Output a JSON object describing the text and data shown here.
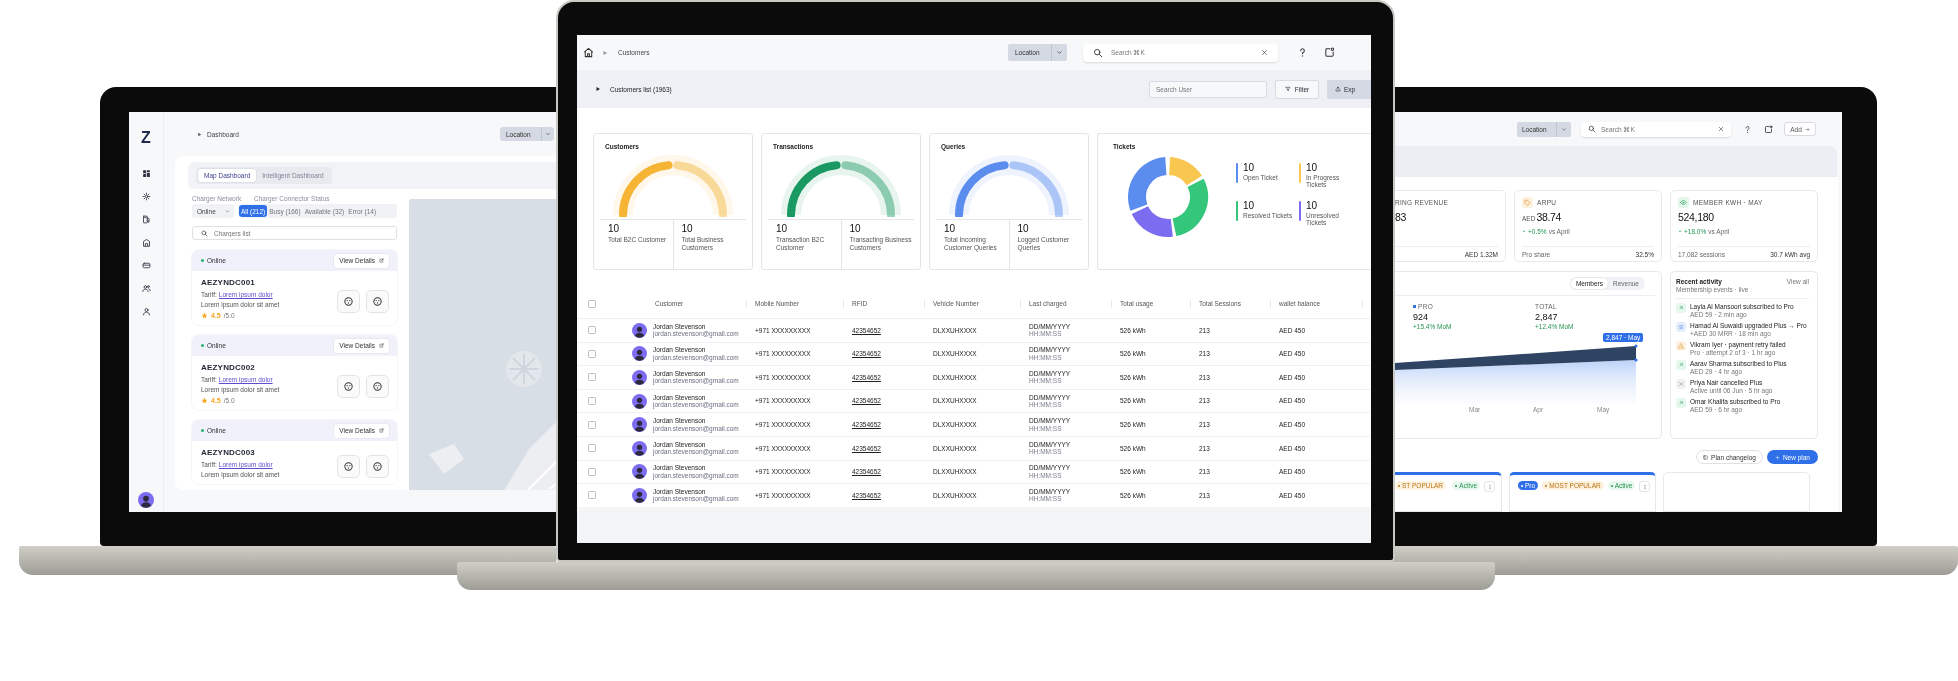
{
  "left_screen": {
    "logo": "Z",
    "breadcrumb": "Dashboard",
    "location": "Location",
    "tabs": [
      {
        "label": "Map Dashboard",
        "selected": true
      },
      {
        "label": "Intelligent Dashboard",
        "selected": false
      }
    ],
    "network": {
      "label": "Charger Network",
      "value": "Online"
    },
    "connector_status": {
      "label": "Charger Connector Status",
      "filters": [
        {
          "label": "All (212)",
          "selected": true
        },
        {
          "label": "Busy (166)",
          "selected": false
        },
        {
          "label": "Available (32)",
          "selected": false
        },
        {
          "label": "Error (14)",
          "selected": false
        }
      ]
    },
    "search": {
      "placeholder": "Chargers list"
    },
    "chargers": [
      {
        "status": "Online",
        "action": "View Details",
        "id": "AEZYNDC001",
        "tariff_label": "Tariff:",
        "tariff": "Lorem ipsum dolor",
        "description": "Lorem ipsum dolor sit amet",
        "rating": "4.5",
        "rating_scale": "/5.0"
      },
      {
        "status": "Online",
        "action": "View Details",
        "id": "AEZYNDC002",
        "tariff_label": "Tariff:",
        "tariff": "Lorem ipsum dolor",
        "description": "Lorem ipsum dolor sit amet",
        "rating": "4.5",
        "rating_scale": "/5.0"
      },
      {
        "status": "Online",
        "action": "View Details",
        "id": "AEZYNDC003",
        "tariff_label": "Tariff:",
        "tariff": "Lorem ipsum dolor",
        "description": "Lorem ipsum dolor sit amet"
      }
    ]
  },
  "main_screen": {
    "breadcrumb": "Customers",
    "location": "Location",
    "search": {
      "placeholder": "Search ⌘K"
    },
    "list_title": "Customers list (1963)",
    "user_search": {
      "placeholder": "Search User"
    },
    "filter_button": "Filter",
    "export_button": "Exp",
    "stat_cards": [
      {
        "title": "Customers",
        "color": "#f5b433",
        "stats": [
          {
            "value": "10",
            "label": "Total B2C Customer"
          },
          {
            "value": "10",
            "label": "Total Business Customers"
          }
        ]
      },
      {
        "title": "Transactions",
        "color": "#1a9a62",
        "stats": [
          {
            "value": "10",
            "label": "Transaction B2C Customer"
          },
          {
            "value": "10",
            "label": "Transacting Business Customers"
          }
        ]
      },
      {
        "title": "Queries",
        "color": "#5b8def",
        "stats": [
          {
            "value": "10",
            "label": "Total Incoming Customer Queries"
          },
          {
            "value": "10",
            "label": "Logged Customer Queries"
          }
        ]
      }
    ],
    "tickets": {
      "title": "Tickets",
      "legend": [
        {
          "value": "10",
          "label": "Open Ticket",
          "color": "#5b8def"
        },
        {
          "value": "10",
          "label": "In Progress Tickets",
          "color": "#f9c74f"
        },
        {
          "value": "10",
          "label": "Resolved Tickets",
          "color": "#34c77b"
        },
        {
          "value": "10",
          "label": "Unresolved Tickets",
          "color": "#7b6cf0"
        }
      ]
    },
    "table": {
      "columns": [
        "Customer",
        "Mobile Number",
        "RFID",
        "Vehicle Number",
        "Last charged",
        "Total usage",
        "Total Sessions",
        "wallet balance"
      ],
      "select_all_checked": false,
      "rows": [
        {
          "checked": false,
          "name": "Jordan Stevenson",
          "email": "jordan.stevenson@gmail.com",
          "mobile": "+971 XXXXXXXXX",
          "rfid": "42354652",
          "vehicle": "DLXXUHXXXX",
          "date": "DD/MM/YYYY",
          "time": "HH:MM:SS",
          "usage": "526 kWh",
          "sessions": "213",
          "balance": "AED 450"
        },
        {
          "checked": false,
          "name": "Jordan Stevenson",
          "email": "jordan.stevenson@gmail.com",
          "mobile": "+971 XXXXXXXXX",
          "rfid": "42354652",
          "vehicle": "DLXXUHXXXX",
          "date": "DD/MM/YYYY",
          "time": "HH:MM:SS",
          "usage": "526 kWh",
          "sessions": "213",
          "balance": "AED 450"
        },
        {
          "checked": false,
          "name": "Jordan Stevenson",
          "email": "jordan.stevenson@gmail.com",
          "mobile": "+971 XXXXXXXXX",
          "rfid": "42354652",
          "vehicle": "DLXXUHXXXX",
          "date": "DD/MM/YYYY",
          "time": "HH:MM:SS",
          "usage": "526 kWh",
          "sessions": "213",
          "balance": "AED 450"
        },
        {
          "checked": false,
          "name": "Jordan Stevenson",
          "email": "jordan.stevenson@gmail.com",
          "mobile": "+971 XXXXXXXXX",
          "rfid": "42354652",
          "vehicle": "DLXXUHXXXX",
          "date": "DD/MM/YYYY",
          "time": "HH:MM:SS",
          "usage": "526 kWh",
          "sessions": "213",
          "balance": "AED 450"
        },
        {
          "checked": false,
          "name": "Jordan Stevenson",
          "email": "jordan.stevenson@gmail.com",
          "mobile": "+971 XXXXXXXXX",
          "rfid": "42354652",
          "vehicle": "DLXXUHXXXX",
          "date": "DD/MM/YYYY",
          "time": "HH:MM:SS",
          "usage": "526 kWh",
          "sessions": "213",
          "balance": "AED 450"
        },
        {
          "checked": false,
          "name": "Jordan Stevenson",
          "email": "jordan.stevenson@gmail.com",
          "mobile": "+971 XXXXXXXXX",
          "rfid": "42354652",
          "vehicle": "DLXXUHXXXX",
          "date": "DD/MM/YYYY",
          "time": "HH:MM:SS",
          "usage": "526 kWh",
          "sessions": "213",
          "balance": "AED 450"
        },
        {
          "checked": false,
          "name": "Jordan Stevenson",
          "email": "jordan.stevenson@gmail.com",
          "mobile": "+971 XXXXXXXXX",
          "rfid": "42354652",
          "vehicle": "DLXXUHXXXX",
          "date": "DD/MM/YYYY",
          "time": "HH:MM:SS",
          "usage": "526 kWh",
          "sessions": "213",
          "balance": "AED 450"
        },
        {
          "checked": false,
          "name": "Jordan Stevenson",
          "email": "jordan.stevenson@gmail.com",
          "mobile": "+971 XXXXXXXXX",
          "rfid": "42354652",
          "vehicle": "DLXXUHXXXX",
          "date": "DD/MM/YYYY",
          "time": "HH:MM:SS",
          "usage": "526 kWh",
          "sessions": "213",
          "balance": "AED 450"
        }
      ]
    }
  },
  "right_screen": {
    "location": "Location",
    "search": {
      "placeholder": "Search ⌘K"
    },
    "add_button": "Add",
    "kpis": [
      {
        "kind": "partial",
        "label": "RING REVENUE",
        "value": "83",
        "footer_value": "AED 1.32M"
      },
      {
        "kind": "tag",
        "label": "ARPU",
        "currency": "AED",
        "value": "38.74",
        "change": "+0.5%",
        "change_note": "vs April",
        "footer_label": "Pro share",
        "footer_value": "32.5%"
      },
      {
        "kind": "energy",
        "label": "MEMBER KWH · MAY",
        "value": "524,180",
        "change": "+18.0%",
        "change_note": "vs April",
        "footer_label": "17,082 sessions",
        "footer_value": "30.7 kWh avg"
      }
    ],
    "chart_panel": {
      "toggle": [
        {
          "label": "Members",
          "selected": true
        },
        {
          "label": "Revenue",
          "selected": false
        }
      ],
      "stats": [
        {
          "kind": "pro",
          "label": "PRO",
          "value": "924",
          "change": "+15.4% MoM"
        },
        {
          "kind": "total",
          "label": "TOTAL",
          "value": "2,847",
          "change": "+12.4% MoM"
        }
      ],
      "tooltip": "2,847 · May",
      "x_labels": [
        "Mar",
        "Apr",
        "May"
      ]
    },
    "activity": {
      "title": "Recent activity",
      "subtitle": "Membership events · live",
      "link": "View all",
      "items": [
        {
          "kind": "subscribe",
          "text": "Layla Al Mansoori subscribed to Pro",
          "meta": "AED 59 · 2 min ago"
        },
        {
          "kind": "upgrade",
          "text": "Hamad Al Suwaidi upgraded Plus → Pro",
          "meta": "+AED 30 MRR · 18 min ago"
        },
        {
          "kind": "warning",
          "text": "Vikram Iyer · payment retry failed",
          "meta": "Pro · attempt 2 of 3 · 1 hr ago"
        },
        {
          "kind": "subscribe",
          "text": "Aarav Sharma subscribed to Plus",
          "meta": "AED 29 · 4 hr ago"
        },
        {
          "kind": "cancel",
          "text": "Priya Nair cancelled Plus",
          "meta": "Active until 06 Jun · 5 hr ago"
        },
        {
          "kind": "subscribe",
          "text": "Omar Khalifa subscribed to Pro",
          "meta": "AED 59 · 6 hr ago"
        }
      ]
    },
    "actions": [
      {
        "kind": "secondary",
        "label": "Plan changelog"
      },
      {
        "kind": "primary",
        "label": "New plan"
      }
    ],
    "plans": [
      {
        "kind": "partial",
        "badges": [
          {
            "kind": "popular",
            "label": "ST POPULAR"
          },
          {
            "kind": "status",
            "label": "Active"
          }
        ]
      },
      {
        "kind": "full",
        "badges": [
          {
            "kind": "tier",
            "label": "Pro"
          },
          {
            "kind": "popular",
            "label": "MOST POPULAR"
          },
          {
            "kind": "status",
            "label": "Active"
          }
        ]
      },
      {
        "kind": "blank"
      }
    ]
  }
}
